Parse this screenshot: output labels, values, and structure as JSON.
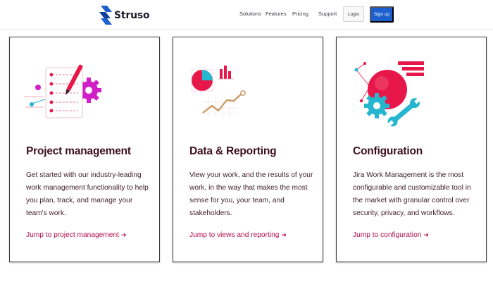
{
  "brand": {
    "name": "Struso",
    "color": "#1d5fcc"
  },
  "nav": {
    "links": [
      "Solutions",
      "Features",
      "Pricing",
      "Support"
    ],
    "login_label": "Login",
    "signup_label": "Sign up"
  },
  "cards": [
    {
      "title": "Project management",
      "description": "Get started with our industry-leading work management functionality to help you plan, track, and manage your team's work.",
      "link": "Jump to project management",
      "arrow": "➜",
      "illustration": "checklist-gear-icon"
    },
    {
      "title": "Data & Reporting",
      "description": "View your work, and the results of your work, in the way that makes the most sense for you, your team, and stakeholders.",
      "link": "Jump to views and reporting",
      "arrow": "➜",
      "illustration": "charts-icon"
    },
    {
      "title": "Configuration",
      "description": "Jira Work Management is the most configurable and customizable tool in the market with granular control over security, privacy, and workflows.",
      "link": "Jump to configuration",
      "arrow": "➜",
      "illustration": "wrench-gear-icon"
    }
  ],
  "colors": {
    "accent": "#e8174a",
    "link": "#b30f4b",
    "heading": "#3d0f21",
    "teal": "#26b6cf",
    "magenta": "#d21ec6",
    "gold": "#c9955c"
  }
}
